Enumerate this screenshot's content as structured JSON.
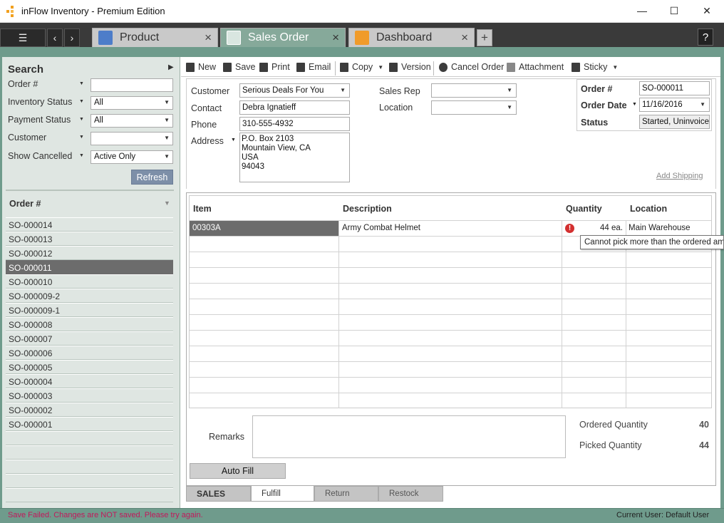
{
  "window": {
    "title": "inFlow Inventory - Premium Edition",
    "minimize": "—",
    "maximize": "☐",
    "close": "✕"
  },
  "tabs": [
    {
      "label": "Product",
      "close": "×"
    },
    {
      "label": "Sales Order",
      "close": "×"
    },
    {
      "label": "Dashboard",
      "close": "×"
    }
  ],
  "tabstrip": {
    "menu_icon": "☰",
    "back": "‹",
    "forward": "›",
    "add": "+",
    "help": "?"
  },
  "search": {
    "title": "Search",
    "fields": [
      {
        "label": "Order #",
        "value": ""
      },
      {
        "label": "Inventory Status",
        "value": "All"
      },
      {
        "label": "Payment Status",
        "value": "All"
      },
      {
        "label": "Customer",
        "value": ""
      },
      {
        "label": "Show Cancelled",
        "value": "Active Only"
      }
    ],
    "refresh": "Refresh"
  },
  "order_list": {
    "header": "Order #",
    "items": [
      "SO-000014",
      "SO-000013",
      "SO-000012",
      "SO-000011",
      "SO-000010",
      "SO-000009-2",
      "SO-000009-1",
      "SO-000008",
      "SO-000007",
      "SO-000006",
      "SO-000005",
      "SO-000004",
      "SO-000003",
      "SO-000002",
      "SO-000001"
    ],
    "selected": "SO-000011"
  },
  "toolbar": {
    "new": "New",
    "save": "Save",
    "print": "Print",
    "email": "Email",
    "copy": "Copy",
    "version": "Version",
    "cancel_order": "Cancel Order",
    "attachment": "Attachment",
    "sticky": "Sticky"
  },
  "form": {
    "customer_label": "Customer",
    "customer": "Serious Deals For You",
    "contact_label": "Contact",
    "contact": "Debra Ignatieff",
    "phone_label": "Phone",
    "phone": "310-555-4932",
    "address_label": "Address",
    "address": [
      "P.O. Box 2103",
      "Mountain View, CA",
      "USA",
      "94043"
    ],
    "sales_rep_label": "Sales Rep",
    "sales_rep": "",
    "location_label": "Location",
    "location": "",
    "order_no_label": "Order #",
    "order_no": "SO-000011",
    "order_date_label": "Order Date",
    "order_date": "11/16/2016",
    "status_label": "Status",
    "status": "Started, Uninvoiced",
    "add_shipping": "Add Shipping"
  },
  "grid": {
    "headers": {
      "item": "Item",
      "description": "Description",
      "quantity": "Quantity",
      "location": "Location"
    },
    "rows": [
      {
        "item": "00303A",
        "description": "Army Combat Helmet",
        "quantity": "44 ea.",
        "location": "Main Warehouse",
        "error": "!"
      }
    ],
    "tooltip": "Cannot pick more than the ordered amount"
  },
  "footer": {
    "remarks_label": "Remarks",
    "ordered_label": "Ordered Quantity",
    "ordered_value": "40",
    "picked_label": "Picked Quantity",
    "picked_value": "44",
    "autofill": "Auto Fill"
  },
  "bottom_tabs": [
    "SALES",
    "Fulfill",
    "Return",
    "Restock"
  ],
  "status": {
    "message": "Save Failed.  Changes are NOT saved.  Please try again.",
    "current_user": "Current User:  Default User"
  },
  "colors": {
    "accent": "#6f9b8c",
    "error": "#c2185b",
    "selected_row": "#6c6c6c"
  }
}
